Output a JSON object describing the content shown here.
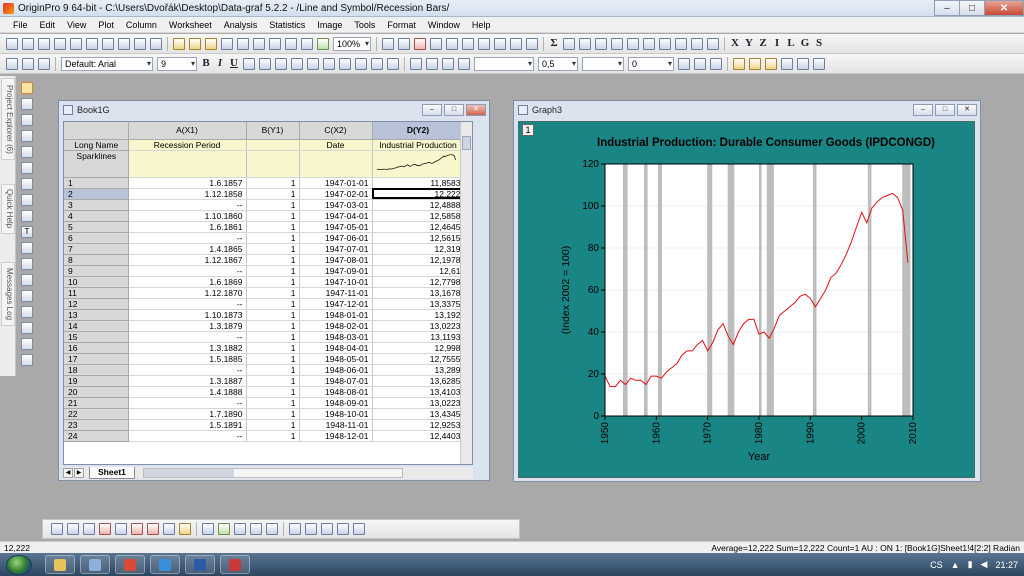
{
  "window": {
    "title": "OriginPro 9 64-bit - C:\\Users\\Dvořák\\Desktop\\Data-graf 5.2.2 - /Line and Symbol/Recession Bars/",
    "min_label": "–",
    "max_label": "□",
    "close_label": "✕"
  },
  "menu": [
    "File",
    "Edit",
    "View",
    "Plot",
    "Column",
    "Worksheet",
    "Analysis",
    "Statistics",
    "Image",
    "Tools",
    "Format",
    "Window",
    "Help"
  ],
  "toolbar": {
    "zoom": "100%",
    "font": "Default: Arial",
    "font_size": "9",
    "bold": "B",
    "italic": "I",
    "underline": "U",
    "line_width": "0,5",
    "pattern_value": "0"
  },
  "left_dock": [
    "Project Explorer (6)",
    "Quick Help",
    "Messages Log"
  ],
  "book": {
    "title": "Book1G",
    "sheet_tab": "Sheet1",
    "columns": [
      {
        "id": "A(X1)",
        "long_name": "Recession Period",
        "sparkline": ""
      },
      {
        "id": "B(Y1)",
        "long_name": "",
        "sparkline": ""
      },
      {
        "id": "C(X2)",
        "long_name": "Date",
        "sparkline": ""
      },
      {
        "id": "D(Y2)",
        "long_name": "Industrial Production",
        "sparkline": "sparkline"
      }
    ],
    "row_labels": {
      "long_name": "Long Name",
      "sparklines": "Sparklines"
    },
    "rows": [
      [
        "1",
        "1.6.1857",
        "1",
        "1947-01-01",
        "11,8583"
      ],
      [
        "2",
        "1.12.1858",
        "1",
        "1947-02-01",
        "12,222"
      ],
      [
        "3",
        "--",
        "1",
        "1947-03-01",
        "12,4888"
      ],
      [
        "4",
        "1.10.1860",
        "1",
        "1947-04-01",
        "12,5858"
      ],
      [
        "5",
        "1.6.1861",
        "1",
        "1947-05-01",
        "12,4645"
      ],
      [
        "6",
        "--",
        "1",
        "1947-06-01",
        "12,5615"
      ],
      [
        "7",
        "1.4.1865",
        "1",
        "1947-07-01",
        "12,319"
      ],
      [
        "8",
        "1.12.1867",
        "1",
        "1947-08-01",
        "12,1978"
      ],
      [
        "9",
        "--",
        "1",
        "1947-09-01",
        "12,61"
      ],
      [
        "10",
        "1.6.1869",
        "1",
        "1947-10-01",
        "12,7798"
      ],
      [
        "11",
        "1.12.1870",
        "1",
        "1947-11-01",
        "13,1678"
      ],
      [
        "12",
        "--",
        "1",
        "1947-12-01",
        "13,3375"
      ],
      [
        "13",
        "1.10.1873",
        "1",
        "1948-01-01",
        "13,192"
      ],
      [
        "14",
        "1.3.1879",
        "1",
        "1948-02-01",
        "13,0223"
      ],
      [
        "15",
        "--",
        "1",
        "1948-03-01",
        "13,1193"
      ],
      [
        "16",
        "1.3.1882",
        "1",
        "1948-04-01",
        "12,998"
      ],
      [
        "17",
        "1.5.1885",
        "1",
        "1948-05-01",
        "12,7555"
      ],
      [
        "18",
        "--",
        "1",
        "1948-06-01",
        "13,289"
      ],
      [
        "19",
        "1.3.1887",
        "1",
        "1948-07-01",
        "13,6285"
      ],
      [
        "20",
        "1.4.1888",
        "1",
        "1948-08-01",
        "13,4103"
      ],
      [
        "21",
        "--",
        "1",
        "1948-09-01",
        "13,0223"
      ],
      [
        "22",
        "1.7.1890",
        "1",
        "1948-10-01",
        "13,4345"
      ],
      [
        "23",
        "1.5.1891",
        "1",
        "1948-11-01",
        "12,9253"
      ],
      [
        "24",
        "--",
        "1",
        "1948-12-01",
        "12,4403"
      ]
    ],
    "active_row": "2"
  },
  "graph": {
    "title": "Graph3",
    "layer": "1"
  },
  "chart_data": {
    "type": "line",
    "title": "Industrial Production: Durable Consumer Goods (IPDCONGD)",
    "xlabel": "Year",
    "ylabel": "(Index 2002 = 100)",
    "xlim": [
      1950,
      2010
    ],
    "ylim": [
      0,
      120
    ],
    "xticks": [
      "1950",
      "1960",
      "1970",
      "1980",
      "1990",
      "2000",
      "2010"
    ],
    "yticks": [
      "0",
      "20",
      "40",
      "60",
      "80",
      "100",
      "120"
    ],
    "grid": true,
    "line_color": "#e01010",
    "bar_color": "#bdbdbd",
    "background_color": "#1a8585",
    "recession_bars": [
      [
        1953.5,
        1954.4
      ],
      [
        1957.6,
        1958.3
      ],
      [
        1960.3,
        1961.1
      ],
      [
        1969.9,
        1970.9
      ],
      [
        1973.9,
        1975.2
      ],
      [
        1980.0,
        1980.5
      ],
      [
        1981.5,
        1982.9
      ],
      [
        1990.5,
        1991.2
      ],
      [
        2001.2,
        2001.9
      ],
      [
        2007.9,
        2009.5
      ]
    ],
    "series": [
      {
        "x": [
          1950,
          1951,
          1952,
          1953,
          1954,
          1955,
          1956,
          1957,
          1958,
          1959,
          1960,
          1961,
          1962,
          1963,
          1964,
          1965,
          1966,
          1967,
          1968,
          1969,
          1970,
          1971,
          1972,
          1973,
          1974,
          1975,
          1976,
          1977,
          1978,
          1979,
          1980,
          1981,
          1982,
          1983,
          1984,
          1985,
          1986,
          1987,
          1988,
          1989,
          1990,
          1991,
          1992,
          1993,
          1994,
          1995,
          1996,
          1997,
          1998,
          1999,
          2000,
          2001,
          2002,
          2003,
          2004,
          2005,
          2006,
          2007,
          2008,
          2009
        ],
        "y": [
          19,
          14,
          14,
          17,
          15,
          18,
          17,
          17,
          15,
          19,
          19,
          18,
          21,
          23,
          25,
          29,
          31,
          31,
          34,
          36,
          31,
          35,
          41,
          44,
          38,
          34,
          40,
          44,
          46,
          46,
          39,
          40,
          37,
          42,
          48,
          50,
          52,
          54,
          57,
          58,
          56,
          52,
          56,
          60,
          66,
          68,
          72,
          77,
          83,
          90,
          97,
          92,
          99,
          102,
          104,
          105,
          106,
          104,
          98,
          73
        ]
      }
    ]
  },
  "status": {
    "left": "12,222",
    "right": "Average=12,222 Sum=12,222 Count=1  AU : ON    1: [Book1G]Sheet1!4[2:2]  Radian"
  },
  "taskbar": {
    "lang": "CS",
    "clock": "21:27",
    "apps": [
      {
        "name": "explorer",
        "color": "#e8c25a"
      },
      {
        "name": "media",
        "color": "#8db0d8"
      },
      {
        "name": "chrome",
        "color": "#d94a3a"
      },
      {
        "name": "ie",
        "color": "#3a8fd9"
      },
      {
        "name": "word",
        "color": "#2a5aa8"
      },
      {
        "name": "origin",
        "color": "#c93a3a"
      }
    ]
  }
}
